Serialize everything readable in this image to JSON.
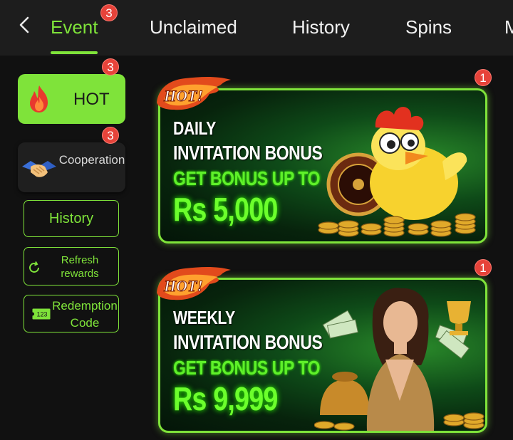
{
  "tabs": [
    {
      "label": "Event",
      "badge": "3",
      "active": true
    },
    {
      "label": "Unclaimed"
    },
    {
      "label": "History"
    },
    {
      "label": "Spins"
    },
    {
      "label": "M"
    }
  ],
  "sidebar": {
    "hot": {
      "label": "HOT",
      "badge": "3"
    },
    "cooperation": {
      "label": "Cooperation",
      "badge": "3"
    },
    "history": {
      "label": "History"
    },
    "refresh": {
      "label": "Refresh rewards"
    },
    "redemption": {
      "label": "Redemption Code",
      "icon_text": "123"
    }
  },
  "banners": [
    {
      "tag": "HOT!",
      "line1": "DAILY",
      "line2": "INVITATION BONUS",
      "line3": "GET BONUS UP TO",
      "amount": "Rs 5,000",
      "badge": "1"
    },
    {
      "tag": "HOT!",
      "line1": "WEEKLY",
      "line2": "INVITATION BONUS",
      "line3": "GET BONUS UP TO",
      "amount": "Rs 9,999",
      "badge": "1"
    }
  ],
  "colors": {
    "accent": "#7fe33a",
    "badge": "#e6433a",
    "background": "#111111",
    "topbar": "#1d1d1d"
  }
}
